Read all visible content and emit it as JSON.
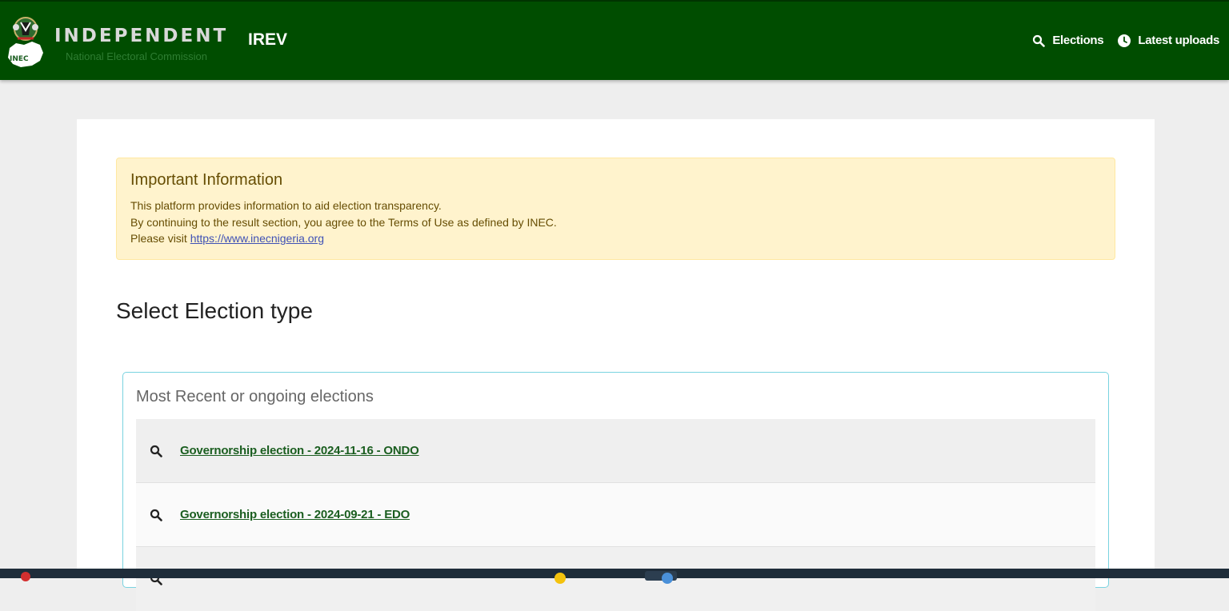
{
  "header": {
    "brand_title": "INDEPENDENT",
    "brand_subtitle": "National Electoral Commission",
    "logo_text": "INEC",
    "app_name": "IREV",
    "nav": [
      {
        "label": "Elections",
        "icon": "search-icon"
      },
      {
        "label": "Latest uploads",
        "icon": "clock-icon"
      }
    ]
  },
  "alert": {
    "heading": "Important Information",
    "line1": "This platform provides information to aid election transparency.",
    "line2": "By continuing to the result section, you agree to the Terms of Use as defined by INEC.",
    "line3_prefix": "Please visit ",
    "link": "https://www.inecnigeria.org"
  },
  "section_title": "Select Election type",
  "elections": {
    "title": "Most Recent or ongoing elections",
    "items": [
      {
        "label": "Governorship election - 2024-11-16 - ONDO",
        "icon": "search-icon"
      },
      {
        "label": "Governorship election - 2024-09-21 - EDO",
        "icon": "search-icon"
      }
    ]
  },
  "taskbar": {
    "badge_text": "",
    "clock": ""
  },
  "colors": {
    "header_bg": "#004d00",
    "alert_bg": "#fff3cd",
    "link_green": "#1b5e20",
    "box_border": "#7ad3e0"
  }
}
